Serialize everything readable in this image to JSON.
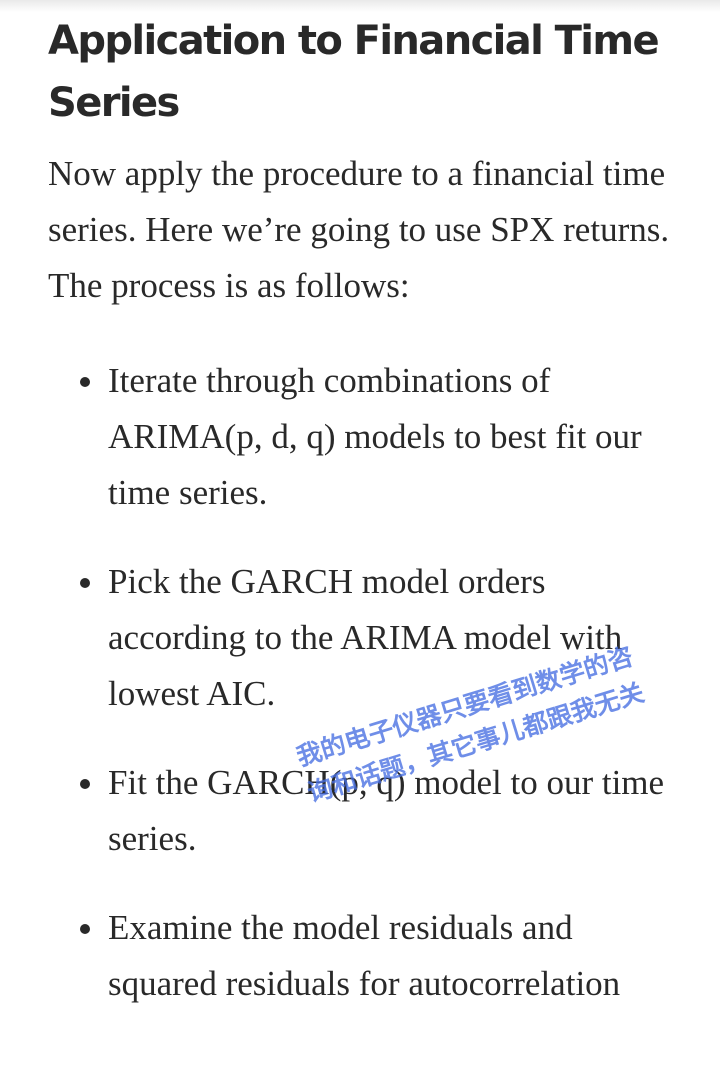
{
  "article": {
    "heading": "Application to Financial Time Series",
    "intro": "Now apply the procedure to a financial time series. Here we’re going to use SPX returns. The process is as follows:",
    "steps": [
      "Iterate through combinations of ARIMA(p, d, q) models to best fit our time series.",
      "Pick the GARCH model orders according to the ARIMA model with lowest AIC.",
      "Fit the GARCH(p, q) model to our time series.",
      "Examine the model residuals and squared residuals for autocorrelation"
    ]
  },
  "watermark": {
    "line1": "我的电子仪器只要看到数学的咨",
    "line2": "询和话题，其它事儿都跟我无关",
    "color": "#466ee1"
  }
}
